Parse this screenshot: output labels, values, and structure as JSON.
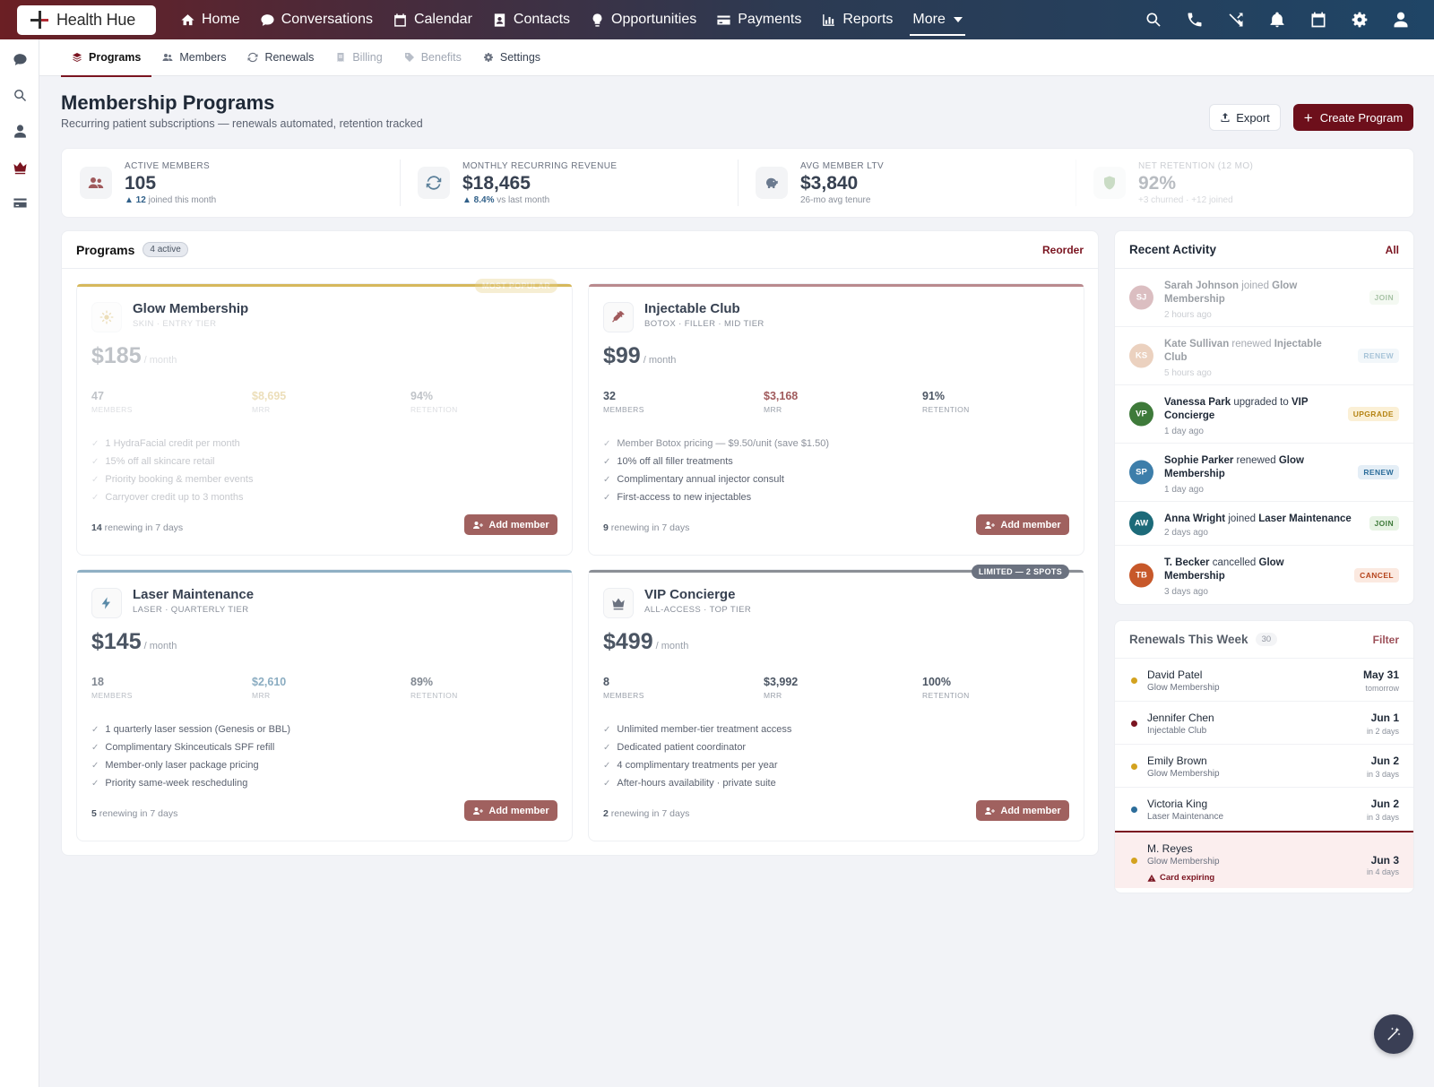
{
  "brand": {
    "name": "Health Hue"
  },
  "nav": {
    "items": [
      {
        "label": "Home",
        "icon": "home-icon"
      },
      {
        "label": "Conversations",
        "icon": "chat-icon"
      },
      {
        "label": "Calendar",
        "icon": "calendar-icon"
      },
      {
        "label": "Contacts",
        "icon": "contacts-icon"
      },
      {
        "label": "Opportunities",
        "icon": "lightbulb-icon"
      },
      {
        "label": "Payments",
        "icon": "card-icon"
      },
      {
        "label": "Reports",
        "icon": "chart-icon"
      },
      {
        "label": "More",
        "icon": "chevron-down-icon"
      }
    ],
    "right_icons": [
      "search-icon",
      "phone-icon",
      "shuffle-icon",
      "bell-icon",
      "calendar-icon",
      "gear-icon",
      "user-icon"
    ]
  },
  "rail": [
    "chat-icon",
    "search-icon",
    "user-icon",
    "crown-icon",
    "card-icon"
  ],
  "subtabs": [
    {
      "label": "Programs",
      "icon": "layers-icon"
    },
    {
      "label": "Members",
      "icon": "users-icon"
    },
    {
      "label": "Renewals",
      "icon": "refresh-icon"
    },
    {
      "label": "Billing",
      "icon": "receipt-icon"
    },
    {
      "label": "Benefits",
      "icon": "tag-icon"
    },
    {
      "label": "Settings",
      "icon": "gear-icon"
    }
  ],
  "header": {
    "title": "Membership Programs",
    "subtitle": "Recurring patient subscriptions — renewals automated, retention tracked",
    "export_label": "Export",
    "create_label": "Create Program"
  },
  "kpis": [
    {
      "label": "ACTIVE MEMBERS",
      "value": "105",
      "delta_strong": "▲ 12",
      "delta_rest": " joined this month",
      "icon": "users-icon"
    },
    {
      "label": "MONTHLY RECURRING REVENUE",
      "value": "$18,465",
      "delta_strong": "▲ 8.4%",
      "delta_rest": " vs last month",
      "icon": "refresh-icon"
    },
    {
      "label": "AVG MEMBER LTV",
      "value": "$3,840",
      "delta_strong": "",
      "delta_rest": "26-mo avg tenure",
      "icon": "piggy-bank-icon"
    },
    {
      "label": "NET RETENTION (12 MO)",
      "value": "92%",
      "delta_strong": "",
      "delta_rest": "+3 churned · +12 joined",
      "icon": "shield-icon"
    }
  ],
  "programs": {
    "title": "Programs",
    "active_badge": "4 active",
    "reorder_label": "Reorder",
    "add_member_label": "Add member",
    "per_month": "/ month",
    "stat_labels": [
      "MEMBERS",
      "MRR",
      "RETENTION"
    ],
    "renewing_suffix": " renewing in 7 days",
    "cards": [
      {
        "name": "Glow Membership",
        "tier": "SKIN · ENTRY TIER",
        "price": "$185",
        "members": "47",
        "mrr": "$8,695",
        "retention": "94%",
        "ribbon": "MOST POPULAR",
        "renewing": "14",
        "accent": "#d6b85c",
        "features": [
          "1 HydraFacial credit per month",
          "15% off all skincare retail",
          "Priority booking & member events",
          "Carryover credit up to 3 months"
        ]
      },
      {
        "name": "Injectable Club",
        "tier": "BOTOX · FILLER · MID TIER",
        "price": "$99",
        "members": "32",
        "mrr": "$3,168",
        "retention": "91%",
        "ribbon": "",
        "renewing": "9",
        "accent": "#b98a8e",
        "features": [
          "Member Botox pricing — $9.50/unit (save $1.50)",
          "10% off all filler treatments",
          "Complimentary annual injector consult",
          "First-access to new injectables"
        ]
      },
      {
        "name": "Laser Maintenance",
        "tier": "LASER · QUARTERLY TIER",
        "price": "$145",
        "members": "18",
        "mrr": "$2,610",
        "retention": "89%",
        "ribbon": "",
        "renewing": "5",
        "accent": "#8fb0c4",
        "features": [
          "1 quarterly laser session (Genesis or BBL)",
          "Complimentary Skinceuticals SPF refill",
          "Member-only laser package pricing",
          "Priority same-week rescheduling"
        ]
      },
      {
        "name": "VIP Concierge",
        "tier": "ALL-ACCESS · TOP TIER",
        "price": "$499",
        "members": "8",
        "mrr": "$3,992",
        "retention": "100%",
        "ribbon": "LIMITED — 2 SPOTS",
        "renewing": "2",
        "accent": "#8b8f96",
        "features": [
          "Unlimited member-tier treatment access",
          "Dedicated patient coordinator",
          "4 complimentary treatments per year",
          "After-hours availability · private suite"
        ]
      }
    ]
  },
  "activity": {
    "title": "Recent Activity",
    "link": "All",
    "items": [
      {
        "initials": "SJ",
        "color": "#b07078",
        "who": "Sarah Johnson",
        "verb": " joined ",
        "what": "Glow Membership",
        "time": "2 hours ago",
        "badge": "JOIN"
      },
      {
        "initials": "KS",
        "color": "#d49a72",
        "who": "Kate Sullivan",
        "verb": " renewed ",
        "what": "Injectable Club",
        "time": "5 hours ago",
        "badge": "RENEW"
      },
      {
        "initials": "VP",
        "color": "#3e7a3a",
        "who": "Vanessa Park",
        "verb": " upgraded to ",
        "what": "VIP Concierge",
        "time": "1 day ago",
        "badge": "UPGRADE"
      },
      {
        "initials": "SP",
        "color": "#3d7eaa",
        "who": "Sophie Parker",
        "verb": " renewed ",
        "what": "Glow Membership",
        "time": "1 day ago",
        "badge": "RENEW"
      },
      {
        "initials": "AW",
        "color": "#1c6a79",
        "who": "Anna Wright",
        "verb": " joined ",
        "what": "Laser Maintenance",
        "time": "2 days ago",
        "badge": "JOIN"
      },
      {
        "initials": "TB",
        "color": "#c7582a",
        "who": "T. Becker",
        "verb": " cancelled ",
        "what": "Glow Membership",
        "time": "3 days ago",
        "badge": "CANCEL"
      }
    ]
  },
  "renewals": {
    "title": "Renewals This Week",
    "count": "30",
    "link": "Filter",
    "items": [
      {
        "name": "David Patel",
        "program": "Glow Membership",
        "date": "May 31",
        "rel": "tomorrow",
        "dot": "#d3a21f"
      },
      {
        "name": "Jennifer Chen",
        "program": "Injectable Club",
        "date": "Jun 1",
        "rel": "in 2 days",
        "dot": "#7a1420"
      },
      {
        "name": "Emily Brown",
        "program": "Glow Membership",
        "date": "Jun 2",
        "rel": "in 3 days",
        "dot": "#d3a21f"
      },
      {
        "name": "Victoria King",
        "program": "Laser Maintenance",
        "date": "Jun 2",
        "rel": "in 3 days",
        "dot": "#2c6d9a"
      },
      {
        "name": "M. Reyes",
        "program": "Glow Membership",
        "date": "Jun 3",
        "rel": "in 4 days",
        "dot": "#d3a21f",
        "warning": "Card expiring"
      }
    ]
  }
}
